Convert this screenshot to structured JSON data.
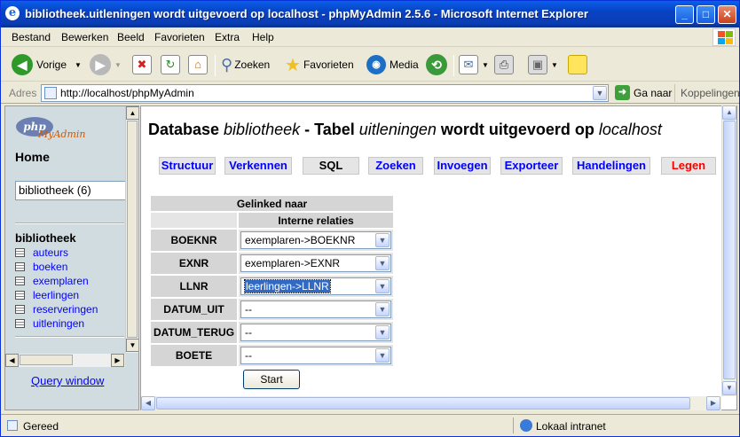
{
  "window": {
    "title": "bibliotheek.uitleningen wordt uitgevoerd op localhost - phpMyAdmin 2.5.6 - Microsoft Internet Explorer",
    "minimize": "_",
    "maximize": "□",
    "close": "✕"
  },
  "menu": [
    "Bestand",
    "Bewerken",
    "Beeld",
    "Favorieten",
    "Extra",
    "Help"
  ],
  "toolbar": {
    "back": "Vorige",
    "search": "Zoeken",
    "favorites": "Favorieten",
    "media": "Media"
  },
  "address": {
    "label": "Adres",
    "url": "http://localhost/phpMyAdmin",
    "go": "Ga naar",
    "links": "Koppelingen"
  },
  "sidebar": {
    "logo_php": "php",
    "logo_my": "MyAdmin",
    "home": "Home",
    "db_select": "bibliotheek (6)",
    "db_name": "bibliotheek",
    "tables": [
      "auteurs",
      "boeken",
      "exemplaren",
      "leerlingen",
      "reserveringen",
      "uitleningen"
    ],
    "query_window": "Query window"
  },
  "main": {
    "heading": {
      "p1": "Database ",
      "db": "bibliotheek",
      "p2": " - Tabel ",
      "table": "uitleningen",
      "p3": " wordt uitgevoerd op ",
      "host": "localhost"
    },
    "tabs": [
      "Structuur",
      "Verkennen",
      "SQL",
      "Zoeken",
      "Invoegen",
      "Exporteer",
      "Handelingen",
      "Legen"
    ],
    "relations": {
      "header1": "Gelinked naar",
      "header2": "Interne relaties",
      "rows": [
        {
          "field": "BOEKNR",
          "value": "exemplaren->BOEKNR"
        },
        {
          "field": "EXNR",
          "value": "exemplaren->EXNR"
        },
        {
          "field": "LLNR",
          "value": "leerlingen->LLNR"
        },
        {
          "field": "DATUM_UIT",
          "value": "--"
        },
        {
          "field": "DATUM_TERUG",
          "value": "--"
        },
        {
          "field": "BOETE",
          "value": "--"
        }
      ],
      "submit": "Start"
    }
  },
  "status": {
    "left": "Gereed",
    "zone": "Lokaal intranet"
  },
  "colors": {
    "titlebar": "#0a3db4",
    "link": "#0000ff",
    "danger_tab": "#ff0000",
    "sidebar_bg": "#d0dce0"
  }
}
